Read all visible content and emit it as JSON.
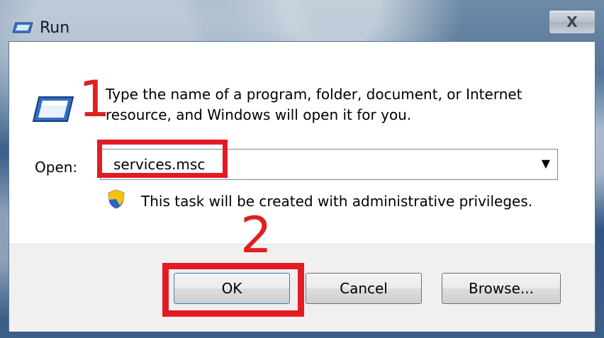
{
  "window": {
    "title": "Run",
    "close_label": "X"
  },
  "dialog": {
    "description": "Type the name of a program, folder, document, or Internet resource, and Windows will open it for you.",
    "open_label": "Open:",
    "open_value": "services.msc",
    "admin_note": "This task will be created with administrative privileges."
  },
  "annotations": {
    "step1": "1",
    "step2": "2",
    "highlight_color": "#e21b24"
  },
  "buttons": {
    "ok": "OK",
    "cancel": "Cancel",
    "browse": "Browse..."
  },
  "icons": {
    "title": "run-icon",
    "main": "run-icon",
    "shield": "uac-shield-icon",
    "dropdown": "chevron-down-icon"
  }
}
